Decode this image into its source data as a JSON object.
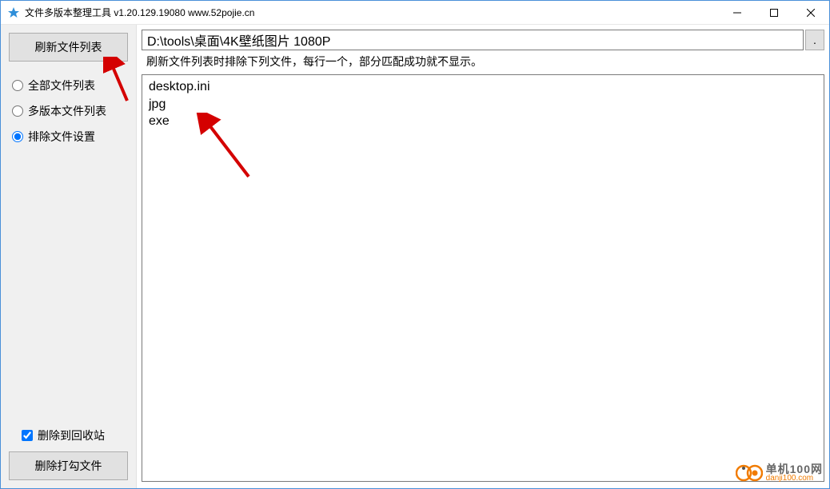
{
  "title": "文件多版本整理工具 v1.20.129.19080 www.52pojie.cn",
  "sidebar": {
    "refresh_btn": "刷新文件列表",
    "radios": {
      "all": "全部文件列表",
      "multi": "多版本文件列表",
      "exclude": "排除文件设置",
      "selected": "exclude"
    },
    "delete_to_recycle": "删除到回收站",
    "delete_to_recycle_checked": true,
    "delete_checked_btn": "删除打勾文件"
  },
  "main": {
    "path_value": "D:\\tools\\桌面\\4K壁纸图片 1080P",
    "browse_label": ".",
    "hint": "刷新文件列表时排除下列文件，每行一个，部分匹配成功就不显示。",
    "exclude_text": "desktop.ini\njpg\nexe"
  },
  "watermark": {
    "top": "单机100网",
    "bottom": "danji100.com"
  }
}
